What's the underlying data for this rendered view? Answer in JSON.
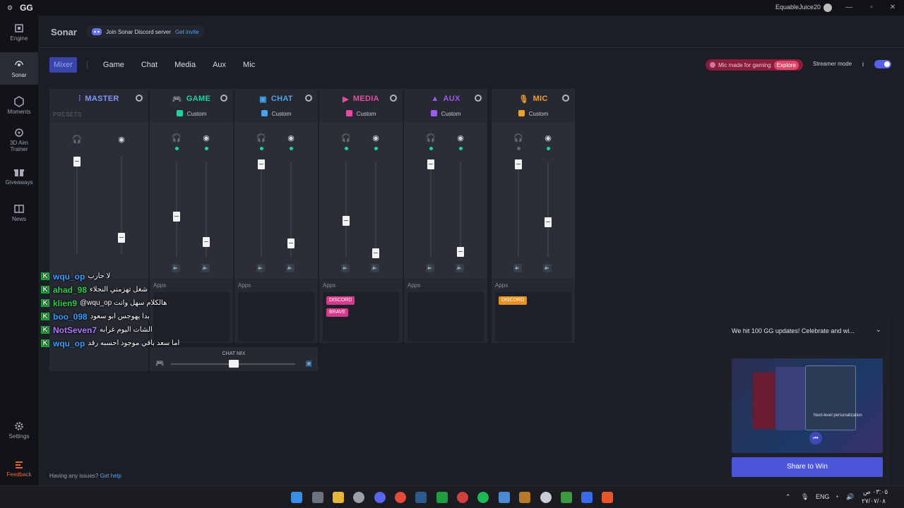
{
  "window": {
    "title": "GG",
    "user": "EquableJuice20"
  },
  "sidebar": {
    "items": [
      {
        "label": "Engine"
      },
      {
        "label": "Sonar"
      },
      {
        "label": "Moments"
      },
      {
        "label": "3D Aim",
        "label2": "Trainer"
      },
      {
        "label": "Giveaways"
      },
      {
        "label": "News"
      },
      {
        "label": "Settings"
      },
      {
        "label": "Feedback"
      }
    ]
  },
  "header": {
    "title": "Sonar",
    "discord_text": "Join Sonar Discord server",
    "discord_link": "Get invite"
  },
  "tabs": [
    "Mixer",
    "Game",
    "Chat",
    "Media",
    "Aux",
    "Mic"
  ],
  "promo": {
    "text": "Mic made for gaming",
    "link": "Explore"
  },
  "streamer": {
    "label": "Streamer mode",
    "info": "i"
  },
  "mixer": {
    "master": {
      "title": "MASTER",
      "presets_label": "PRESETS"
    },
    "channels": [
      {
        "title": "GAME",
        "preset": "Custom",
        "color": "#1fd3a0"
      },
      {
        "title": "CHAT",
        "preset": "Custom",
        "color": "#4aa3e8"
      },
      {
        "title": "MEDIA",
        "preset": "Custom",
        "color": "#e84aa0"
      },
      {
        "title": "AUX",
        "preset": "Custom",
        "color": "#9b5cf0"
      },
      {
        "title": "MIC",
        "preset": "Custom",
        "color": "#f0a030"
      }
    ],
    "apps_label": "Apps",
    "media_apps": [
      "DISCORD",
      "BRAVE"
    ],
    "mic_apps": [
      "DISCORD"
    ],
    "chatmix_label": "CHAT MIX"
  },
  "chat": [
    {
      "user": "wqu_op",
      "color": "#3aa0ff",
      "msg": "لا حارب"
    },
    {
      "user": "ahad_98",
      "color": "#2ad14a",
      "msg": "شغل تهزمني النجلاء"
    },
    {
      "user": "klien9",
      "color": "#2ad14a",
      "msg": "@wqu_op هالكلام سهل وانت"
    },
    {
      "user": "boo_098",
      "color": "#3aa0ff",
      "msg": "بدا يهوجس ابو سعود"
    },
    {
      "user": "NotSeven7",
      "color": "#b07aff",
      "msg": "الشات اليوم غرابه"
    },
    {
      "user": "wqu_op",
      "color": "#3aa0ff",
      "msg": "اما سعد باقي موجود احسبه رقد"
    }
  ],
  "help": {
    "text": "Having any issues?",
    "link": "Get help"
  },
  "notification": {
    "title": "We hit 100 GG updates! Celebrate and wi...",
    "button": "Share to Win",
    "card_text": "Next-level personalization"
  },
  "taskbar": {
    "lang": "ENG",
    "time": "٠٣:٠٥ ص",
    "date": "٢٧/٠٧/٠٨"
  }
}
